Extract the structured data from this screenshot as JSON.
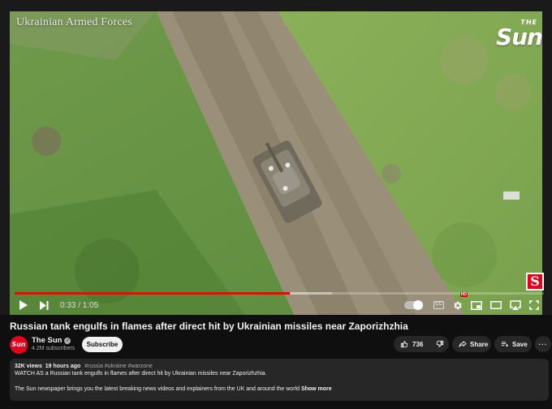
{
  "video": {
    "watermark": "Ukrainian Armed Forces",
    "brand_small": "THE",
    "brand_big": "Sun",
    "corner_badge": "S",
    "progress_fraction": 0.52,
    "time_display": "0:33 / 1:05"
  },
  "controls": {
    "play_icon": "play-icon",
    "next_icon": "next-icon",
    "autoplay_icon": "autoplay-toggle-icon",
    "captions_icon": "captions-icon",
    "settings_icon": "gear-icon",
    "miniplayer_icon": "miniplayer-icon",
    "theater_icon": "theater-icon",
    "cast_icon": "airplay-icon",
    "fullscreen_icon": "fullscreen-icon"
  },
  "title": "Russian tank engulfs in flames after direct hit by Ukrainian missiles near Zaporizhzhia",
  "channel": {
    "name": "The Sun",
    "avatar_text": "Sun",
    "subscribers": "4.2M subscribers",
    "subscribe_label": "Subscribe"
  },
  "actions": {
    "likes": "736",
    "share_label": "Share",
    "save_label": "Save",
    "more_label": "···"
  },
  "description": {
    "views": "32K views",
    "age": "19 hours ago",
    "tags": "#russia #ukraine #warzone",
    "line1": "WATCH AS a Russian tank engulfs in flames after direct hit by Ukrainian missiles near Zaporizhzhia.",
    "line2": "The Sun newspaper brings you the latest breaking news videos and explainers from the UK and around the world",
    "show_more": "Show more"
  },
  "colors": {
    "accent": "#ff0000",
    "brand_red": "#e4001b",
    "background": "#0f0f0f",
    "surface": "#272727"
  }
}
